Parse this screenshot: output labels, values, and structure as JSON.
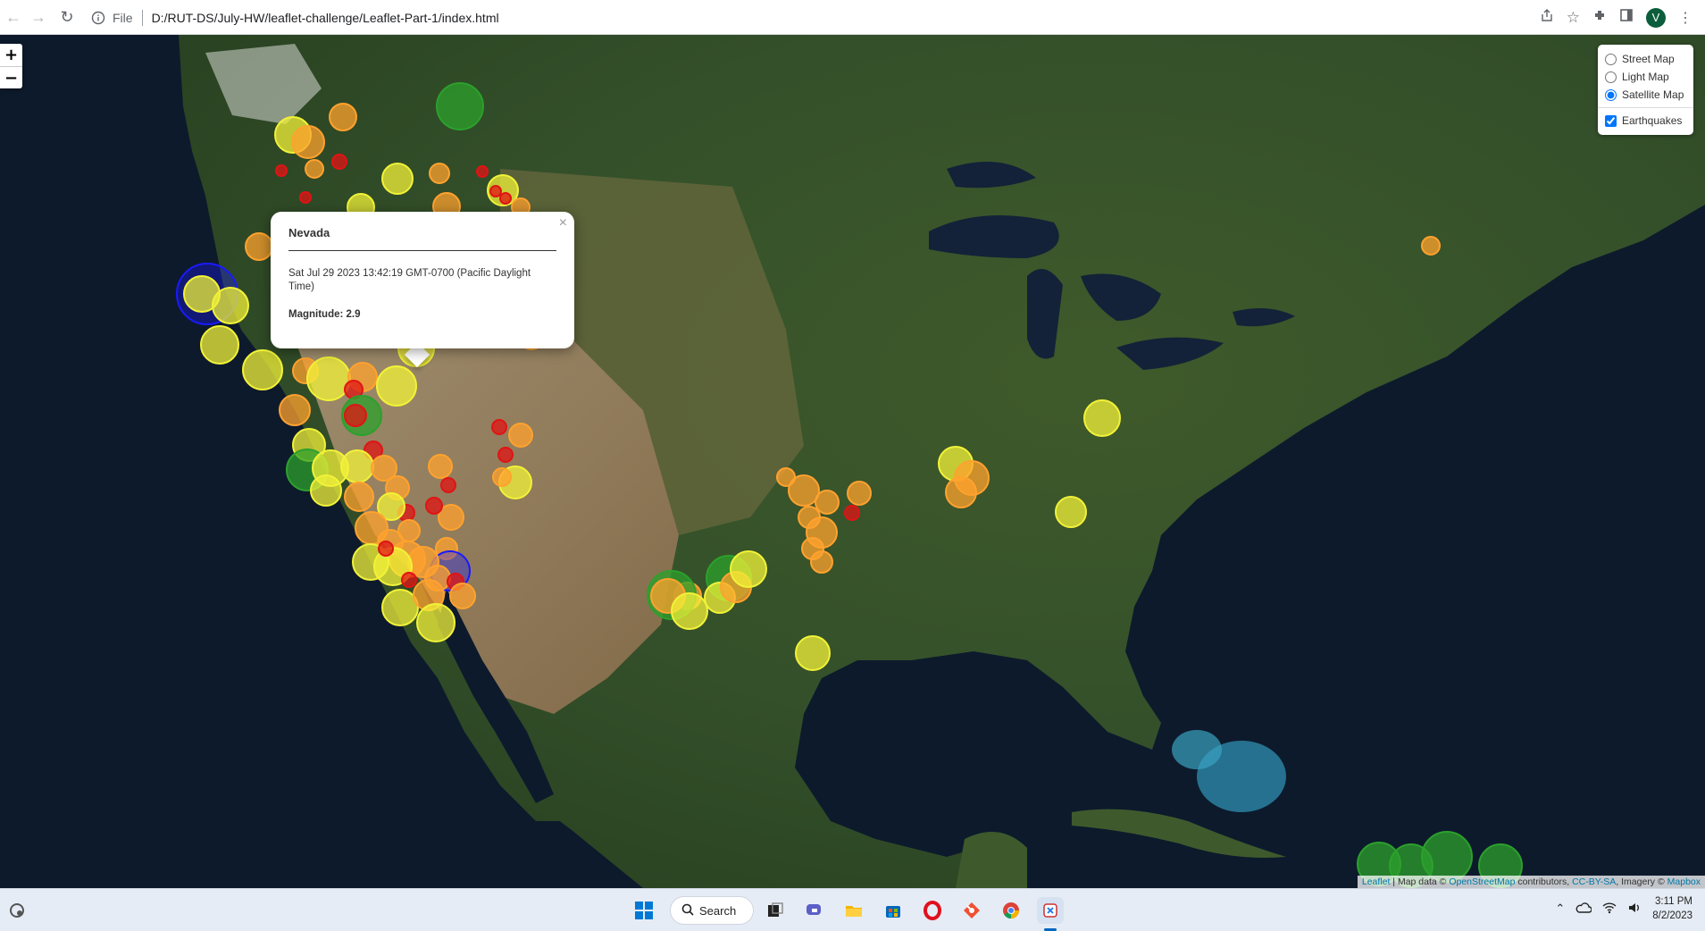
{
  "browser": {
    "scheme_label": "File",
    "url": "D:/RUT-DS/July-HW/leaflet-challenge/Leaflet-Part-1/index.html",
    "avatar_initial": "V"
  },
  "map": {
    "zoom_in": "+",
    "zoom_out": "−",
    "layers": {
      "base_layers": [
        {
          "label": "Street Map",
          "selected": false
        },
        {
          "label": "Light Map",
          "selected": false
        },
        {
          "label": "Satellite Map",
          "selected": true
        }
      ],
      "overlays": [
        {
          "label": "Earthquakes",
          "checked": true
        }
      ]
    },
    "popup": {
      "title": "Nevada",
      "time": "Sat Jul 29 2023 13:42:19 GMT-0700 (Pacific Daylight Time)",
      "magnitude": "Magnitude: 2.9",
      "close": "×"
    },
    "attribution": {
      "leaflet": "Leaflet",
      "sep1": " | Map data © ",
      "osm": "OpenStreetMap",
      "sep2": " contributors, ",
      "license": "CC-BY-SA",
      "sep3": ", Imagery © ",
      "provider": "Mapbox"
    },
    "marker_colors": {
      "shallow": "#f2f238",
      "light": "#ffa22e",
      "deep": "#e01414",
      "green": "#2ca02c",
      "blue": "#1a1aff"
    }
  },
  "taskbar": {
    "search_label": "Search",
    "time": "3:11 PM",
    "date": "8/2/2023"
  }
}
